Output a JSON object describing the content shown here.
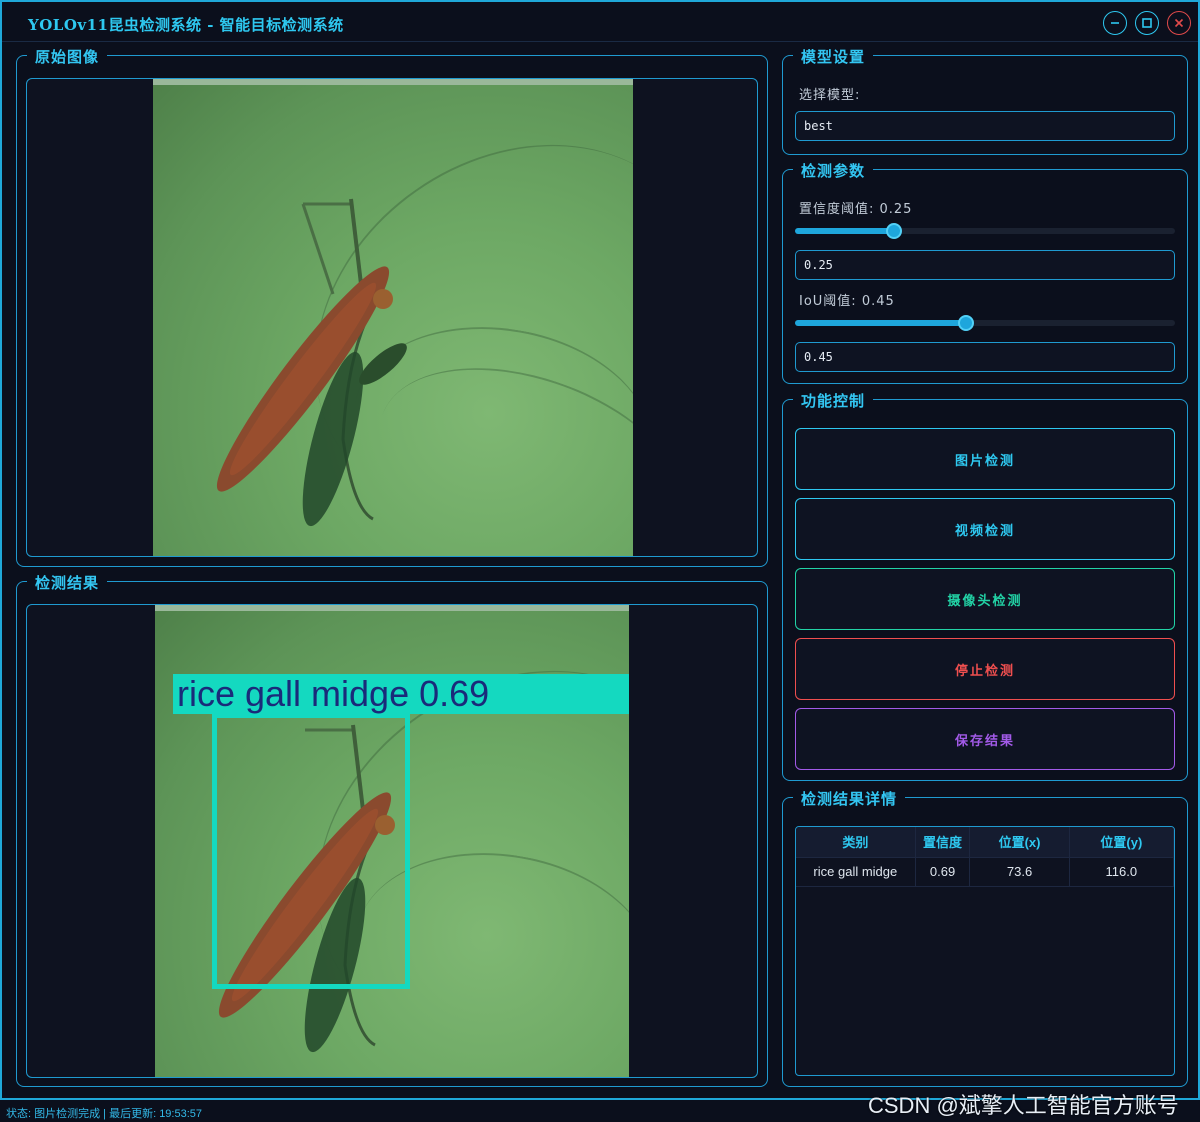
{
  "window": {
    "title": "YOLOv11昆虫检测系统 - 智能目标检测系统"
  },
  "left": {
    "original_title": "原始图像",
    "result_title": "检测结果",
    "detection": {
      "label": "rice gall midge 0.69",
      "color": "#14d9c0"
    }
  },
  "model": {
    "group_title": "模型设置",
    "select_label": "选择模型:",
    "selected": "best"
  },
  "params": {
    "group_title": "检测参数",
    "conf_label": "置信度阈值: 0.25",
    "conf_value": "0.25",
    "conf_fraction": 0.25,
    "iou_label": "IoU阈值: 0.45",
    "iou_value": "0.45",
    "iou_fraction": 0.45
  },
  "controls": {
    "group_title": "功能控制",
    "buttons": [
      {
        "label": "图片检测",
        "color": "#2ec8f0"
      },
      {
        "label": "视频检测",
        "color": "#2ec8f0"
      },
      {
        "label": "摄像头检测",
        "color": "#22d3a6"
      },
      {
        "label": "停止检测",
        "color": "#ef4f4f"
      },
      {
        "label": "保存结果",
        "color": "#a25ae8"
      }
    ]
  },
  "details": {
    "group_title": "检测结果详情",
    "columns": [
      "类别",
      "置信度",
      "位置(x)",
      "位置(y)"
    ],
    "rows": [
      [
        "rice gall midge",
        "0.69",
        "73.6",
        "116.0"
      ]
    ]
  },
  "status": {
    "text": "状态: 图片检测完成 | 最后更新: 19:53:57"
  },
  "watermark": "CSDN @斌擎人工智能官方账号",
  "icons": {
    "minimize": "minimize-icon",
    "maximize": "maximize-icon",
    "close": "close-icon"
  }
}
